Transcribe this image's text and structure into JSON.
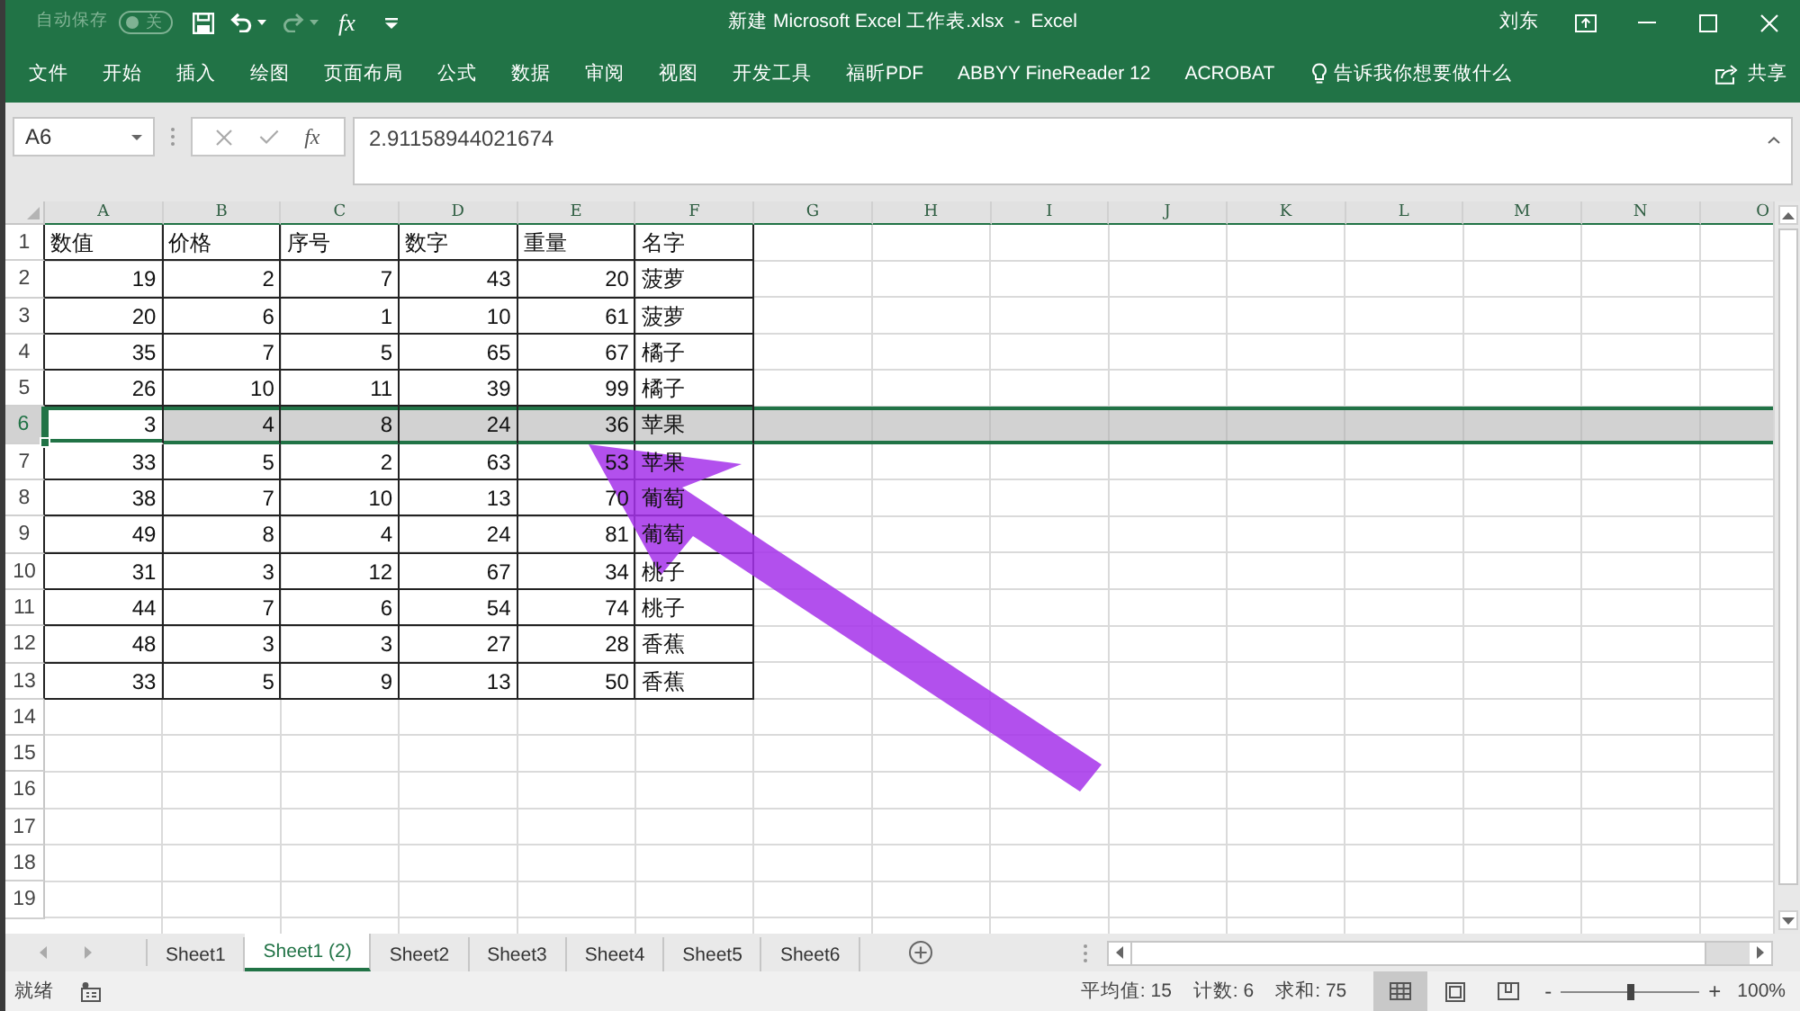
{
  "title_bar": {
    "autosave": {
      "label": "自动保存",
      "state_text": "关",
      "on": false
    },
    "quick_access": [
      {
        "kind": "save",
        "disabled": false
      },
      {
        "kind": "undo",
        "disabled": false
      },
      {
        "kind": "redo",
        "disabled": true
      },
      {
        "kind": "function",
        "label": "fx",
        "disabled": false
      },
      {
        "kind": "customize",
        "disabled": false
      }
    ],
    "title": "新建 Microsoft Excel 工作表.xlsx  -  Excel",
    "user": "刘东"
  },
  "ribbon_tabs": [
    "文件",
    "开始",
    "插入",
    "绘图",
    "页面布局",
    "公式",
    "数据",
    "审阅",
    "视图",
    "开发工具",
    "福昕PDF",
    "ABBYY FineReader 12",
    "ACROBAT"
  ],
  "tell_me": "告诉我你想要做什么",
  "share": "共享",
  "formula_bar": {
    "name_box": "A6",
    "function_label": "fx",
    "formula": "2.91158944021674"
  },
  "sheet": {
    "columns": [
      "A",
      "B",
      "C",
      "D",
      "E",
      "F",
      "G",
      "H",
      "I",
      "J",
      "K",
      "L",
      "M",
      "N",
      "O"
    ],
    "rows": [
      {
        "header": "1",
        "selected": false,
        "cells": [
          "数值",
          "价格",
          "序号",
          "数字",
          "重量",
          "名字"
        ]
      },
      {
        "header": "2",
        "selected": false,
        "cells": [
          "19",
          "2",
          "7",
          "43",
          "20",
          "菠萝"
        ]
      },
      {
        "header": "3",
        "selected": false,
        "cells": [
          "20",
          "6",
          "1",
          "10",
          "61",
          "菠萝"
        ]
      },
      {
        "header": "4",
        "selected": false,
        "cells": [
          "35",
          "7",
          "5",
          "65",
          "67",
          "橘子"
        ]
      },
      {
        "header": "5",
        "selected": false,
        "cells": [
          "26",
          "10",
          "11",
          "39",
          "99",
          "橘子"
        ]
      },
      {
        "header": "6",
        "selected": true,
        "cells": [
          "3",
          "4",
          "8",
          "24",
          "36",
          "苹果"
        ]
      },
      {
        "header": "7",
        "selected": false,
        "cells": [
          "33",
          "5",
          "2",
          "63",
          "53",
          "苹果"
        ]
      },
      {
        "header": "8",
        "selected": false,
        "cells": [
          "38",
          "7",
          "10",
          "13",
          "70",
          "葡萄"
        ]
      },
      {
        "header": "9",
        "selected": false,
        "cells": [
          "49",
          "8",
          "4",
          "24",
          "81",
          "葡萄"
        ]
      },
      {
        "header": "10",
        "selected": false,
        "cells": [
          "31",
          "3",
          "12",
          "67",
          "34",
          "桃子"
        ]
      },
      {
        "header": "11",
        "selected": false,
        "cells": [
          "44",
          "7",
          "6",
          "54",
          "74",
          "桃子"
        ]
      },
      {
        "header": "12",
        "selected": false,
        "cells": [
          "48",
          "3",
          "3",
          "27",
          "28",
          "香蕉"
        ]
      },
      {
        "header": "13",
        "selected": false,
        "cells": [
          "33",
          "5",
          "9",
          "13",
          "50",
          "香蕉"
        ]
      },
      {
        "header": "14",
        "selected": false
      },
      {
        "header": "15",
        "selected": false
      },
      {
        "header": "16",
        "selected": false
      },
      {
        "header": "17",
        "selected": false
      },
      {
        "header": "18",
        "selected": false
      },
      {
        "header": "19",
        "selected": false
      }
    ]
  },
  "sheet_tabs": [
    {
      "label": "Sheet1",
      "selected": false
    },
    {
      "label": "Sheet1 (2)",
      "selected": true
    },
    {
      "label": "Sheet2",
      "selected": false
    },
    {
      "label": "Sheet3",
      "selected": false
    },
    {
      "label": "Sheet4",
      "selected": false
    },
    {
      "label": "Sheet5",
      "selected": false
    },
    {
      "label": "Sheet6",
      "selected": false
    }
  ],
  "status_bar": {
    "status": "就绪",
    "stats": [
      "平均值: 15",
      "计数: 6",
      "求和: 75"
    ],
    "views": [
      {
        "kind": "normal",
        "selected": true
      },
      {
        "kind": "page_layout",
        "selected": false
      },
      {
        "kind": "page_break",
        "selected": false
      }
    ],
    "zoom": {
      "out": "-",
      "in": "+",
      "level": 0.5,
      "reading": "100%"
    }
  }
}
